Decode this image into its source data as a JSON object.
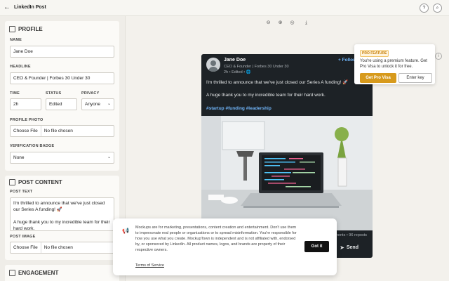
{
  "app": {
    "title": "LinkedIn Post"
  },
  "profile": {
    "section_title": "PROFILE",
    "name_label": "NAME",
    "name_value": "Jane Doe",
    "headline_label": "HEADLINE",
    "headline_value": "CEO & Founder | Forbes 30 Under 30",
    "time_label": "TIME",
    "time_value": "2h",
    "status_label": "STATUS",
    "status_value": "Edited",
    "privacy_label": "PRIVACY",
    "privacy_value": "Anyone",
    "photo_label": "PROFILE PHOTO",
    "photo_button": "Choose File",
    "photo_status": "No file chosen",
    "badge_label": "VERIFICATION BADGE",
    "badge_value": "None"
  },
  "content": {
    "section_title": "POST CONTENT",
    "text_label": "POST TEXT",
    "text_value": "I'm thrilled to announce that we've just closed our Series A funding! 🚀\n\nA huge thank you to my incredible team for their hard work.",
    "image_label": "POST IMAGE",
    "image_button": "Choose File",
    "image_status": "No file chosen"
  },
  "engagement": {
    "section_title": "ENGAGEMENT"
  },
  "preview": {
    "name": "Jane Doe",
    "headline": "CEO & Founder | Forbes 30 Under 30",
    "meta": "2h • Edited • 🌐",
    "follow": "+ Follow",
    "text_line1": "I'm thrilled to announce that we've just closed our Series A funding! 🚀",
    "text_line2": "A huge thank you to my incredible team for their hard work.",
    "hashtags": "#startup #funding #leadership",
    "stats": "ments • 96 reposts",
    "send": "Send"
  },
  "pro_popup": {
    "badge": "PRO FEATURE",
    "text": "You're using a premium feature. Get Pro Visa to unlock it for free.",
    "get_button": "Get Pro Visa",
    "key_button": "Enter key"
  },
  "cookie": {
    "text": "Mockups are for marketing, presentations, content creation and entertainment. Don't use them to impersonate real people or organizations or to spread misinformation. You're responsible for how you use what you create. MockupTown is independent and is not affiliated with, endorsed by, or sponsored by LinkedIn. All product names, logos, and brands are property of their respective owners.",
    "link": "Terms of Service",
    "button": "Got it"
  }
}
